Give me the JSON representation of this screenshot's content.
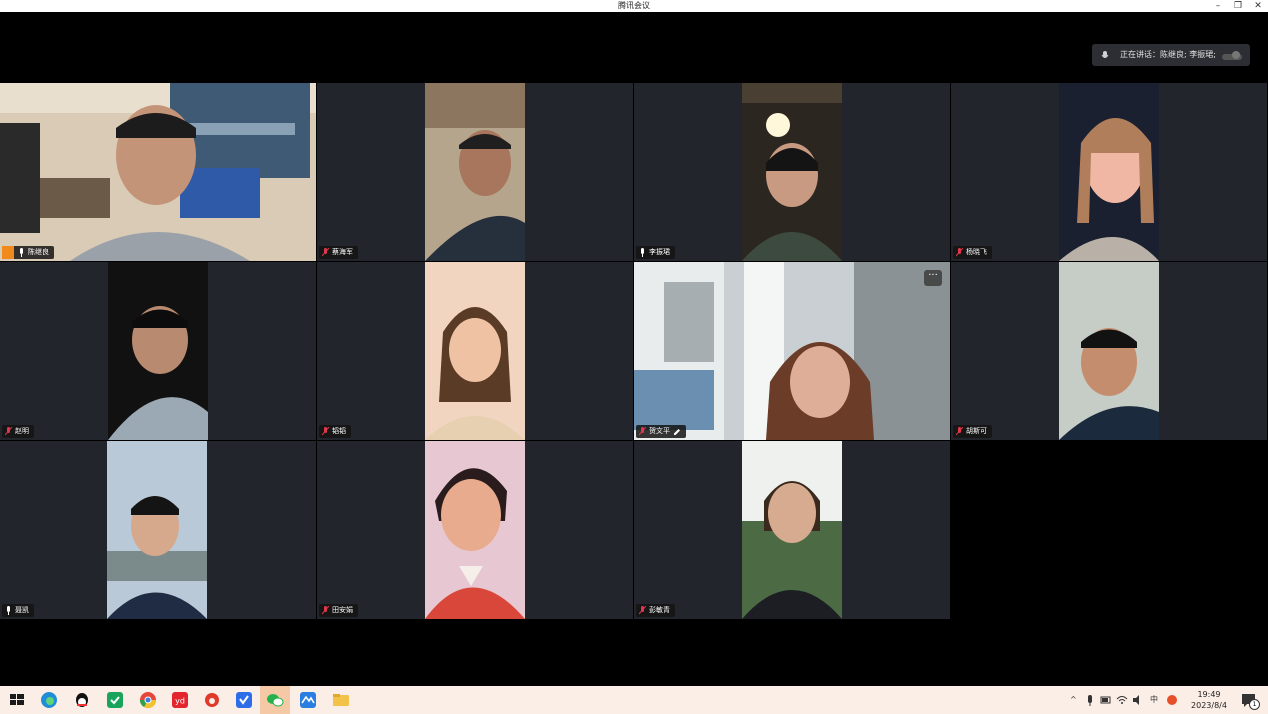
{
  "window": {
    "title": "腾讯会议",
    "minimize": "–",
    "restore": "❐",
    "close": "✕"
  },
  "speaking_bar": {
    "label": "正在讲话：陈继良; 李振珺;"
  },
  "participants": [
    {
      "name": "陈继良",
      "host": true,
      "active": true
    },
    {
      "name": "蔡海军"
    },
    {
      "name": "李振珺"
    },
    {
      "name": "杨晓飞"
    },
    {
      "name": "赵明"
    },
    {
      "name": "韬韬"
    },
    {
      "name": "贺文平",
      "editable": true,
      "more": "···"
    },
    {
      "name": "胡斯可"
    },
    {
      "name": "聂凯"
    },
    {
      "name": "田安娟"
    },
    {
      "name": "彭敏青"
    }
  ],
  "taskbar": {
    "apps": [
      "start-icon",
      "edge-icon",
      "qq-icon",
      "green-app-icon",
      "chrome-icon",
      "youdao-icon",
      "weibo-icon",
      "tencent-docs-icon",
      "wechat-icon",
      "meeting-icon",
      "explorer-icon"
    ],
    "tray_input": "中",
    "time": "19:49",
    "date": "2023/8/4",
    "notification_count": "1"
  },
  "colors": {
    "active_border": "#2ba94a",
    "host_badge": "#f08a1c",
    "muted_mic": "#e0374a"
  }
}
